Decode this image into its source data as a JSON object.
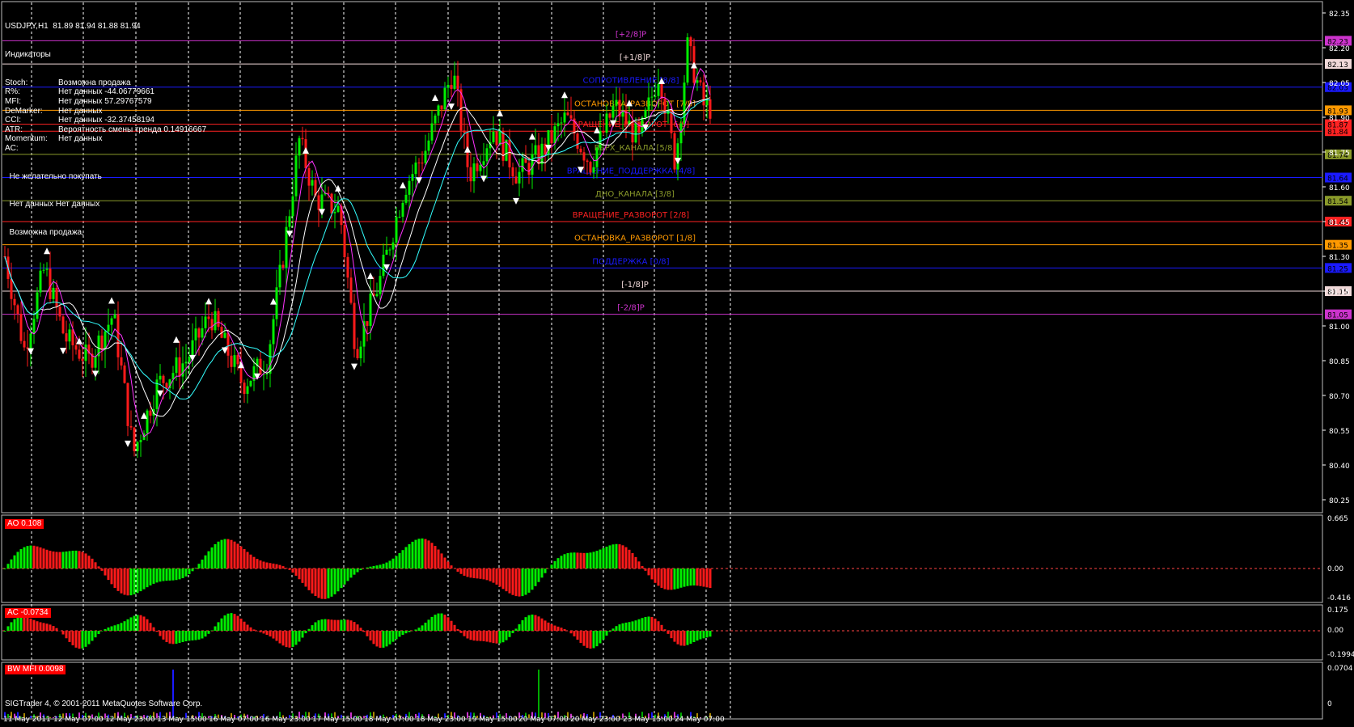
{
  "header": {
    "title": "USDJPY,H1  81.89 81.94 81.88 81.94",
    "subtitle": "Индикаторы"
  },
  "indicators": [
    {
      "key": "Stoch:",
      "val": "Возможна продажа"
    },
    {
      "key": "R%:",
      "val": "Нет данных -44.06779661"
    },
    {
      "key": "MFI:",
      "val": "Нет данных 57.29767579"
    },
    {
      "key": "DeMarker:",
      "val": "Нет данных"
    },
    {
      "key": "CCI:",
      "val": "Нет данных -32.37458194"
    },
    {
      "key": "ATR:",
      "val": "Вероятность смены тренда 0.14916667"
    },
    {
      "key": "Momentum:",
      "val": "Нет данных"
    },
    {
      "key": "AC:",
      "val": ""
    }
  ],
  "indicator_notes": [
    "  Не желательно покупать",
    "  Нет данных Нет данных",
    "  Возможна продажа,"
  ],
  "price_axis": [
    "82.35",
    "82.20",
    "82.05",
    "81.90",
    "81.75",
    "81.60",
    "81.45",
    "81.30",
    "81.15",
    "81.00",
    "80.85",
    "80.70",
    "80.55",
    "80.40",
    "80.25"
  ],
  "murrey_levels": [
    {
      "label": "[+2/8]P",
      "price": "82.23",
      "color": "#cc33cc"
    },
    {
      "label": "[+1/8]P",
      "price": "82.13",
      "color": "#f0d8d8"
    },
    {
      "label": "СОПРОТИВЛЕНИЕ [8/8]",
      "price": "82.03",
      "color": "#1a1aff"
    },
    {
      "label": "ОСТАНОВКА_РАЗВОРОТ [7/8]",
      "price": "81.93",
      "color": "#ff9900"
    },
    {
      "label": "ВРАЩЕНИЕ_РАЗВОРОТ [6/8]",
      "price": "81.84",
      "color": "#ff2222"
    },
    {
      "label": "ВЕРХ_КАНАЛА [5/8]",
      "price": "81.74",
      "color": "#8a9a2a"
    },
    {
      "label": "ВРАЩЕНИЕ_ПОДДЕРЖКА [4/8]",
      "price": "81.64",
      "color": "#1a1aff"
    },
    {
      "label": "ДНО_КАНАЛА [3/8]",
      "price": "81.54",
      "color": "#8a9a2a"
    },
    {
      "label": "ВРАЩЕНИЕ_РАЗВОРОТ [2/8]",
      "price": "81.45",
      "color": "#ff2222"
    },
    {
      "label": "ОСТАНОВКА_РАЗВОРОТ [1/8]",
      "price": "81.35",
      "color": "#ff9900"
    },
    {
      "label": "ПОДДЕРЖКА [0/8]",
      "price": "81.25",
      "color": "#1a1aff"
    },
    {
      "label": "[-1/8]P",
      "price": "81.15",
      "color": "#f0d8d8"
    },
    {
      "label": "[-2/8]P",
      "price": "81.05",
      "color": "#cc33cc"
    }
  ],
  "extra_badge": {
    "price": "81.87",
    "color": "#ff2222"
  },
  "ao": {
    "label": "AO 0.108",
    "axis": [
      "0.665",
      "0.00",
      "-0.416"
    ]
  },
  "ac": {
    "label": "AC -0.0734",
    "axis": [
      "0.175",
      "0.00",
      "-0.1994"
    ]
  },
  "bwmfi": {
    "label": "BW MFI 0.0098",
    "axis": [
      "0.0704",
      "0"
    ]
  },
  "time_axis": [
    "11 May 2011",
    "12 May 07:00",
    "12 May 23:00",
    "13 May 15:00",
    "16 May 07:00",
    "16 May 23:00",
    "17 May 15:00",
    "18 May 07:00",
    "18 May 23:00",
    "19 May 15:00",
    "20 May 07:00",
    "20 May 23:00",
    "23 May 15:00",
    "24 May 07:00"
  ],
  "copyright": "SIGTrader 4, © 2001-2011 MetaQuotes Software Corp.",
  "colors": {
    "bull": "#00ee00",
    "bear": "#ff1a1a",
    "grid": "#ffffff",
    "bg": "#000000",
    "ma_fast": "#ff33ff",
    "ma_mid": "#ffffff",
    "ma_slow": "#33ffff"
  }
}
